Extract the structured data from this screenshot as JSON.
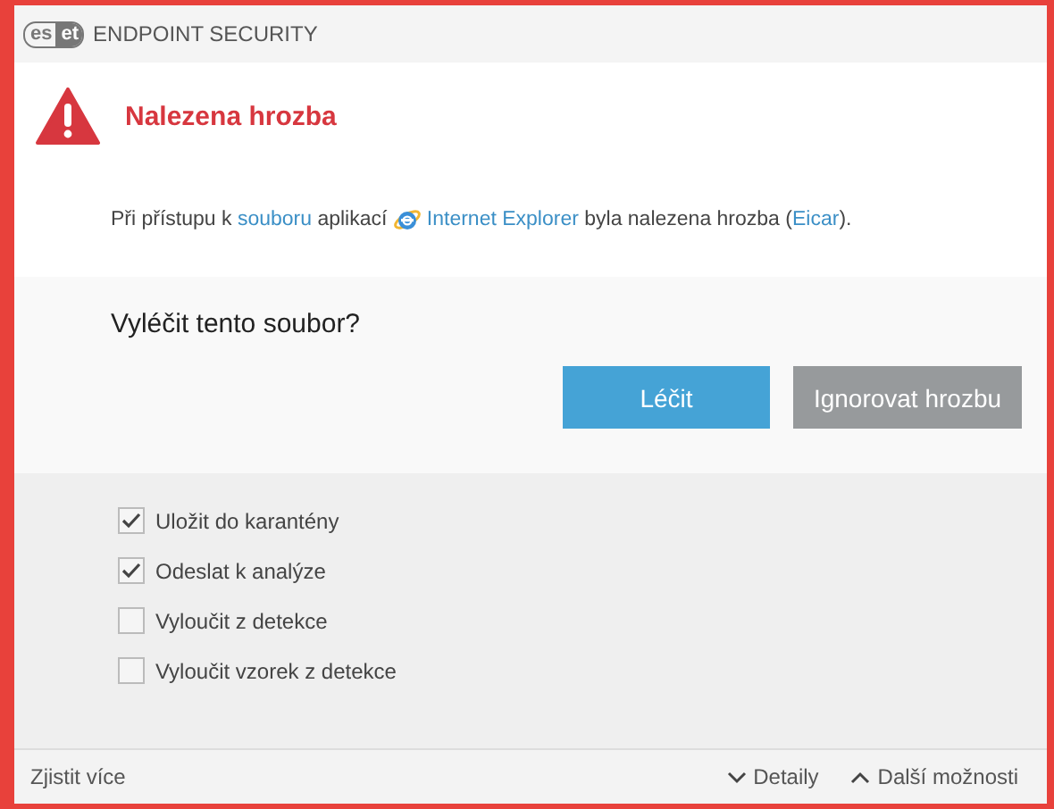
{
  "window": {
    "logo": [
      "es",
      "et"
    ],
    "title": "ENDPOINT SECURITY"
  },
  "alert": {
    "heading": "Nalezena hrozba",
    "message": [
      {
        "kind": "text",
        "text": "Při přístupu k "
      },
      {
        "kind": "link",
        "text": "souboru"
      },
      {
        "kind": "text",
        "text": " aplikací "
      },
      {
        "kind": "app",
        "text": "Internet Explorer"
      },
      {
        "kind": "text",
        "text": " byla nalezena hrozba ("
      },
      {
        "kind": "link",
        "text": "Eicar"
      },
      {
        "kind": "text",
        "text": ")."
      }
    ]
  },
  "question": "Vyléčit tento soubor?",
  "buttons": [
    {
      "label": "Léčit",
      "kind": "primary"
    },
    {
      "label": "Ignorovat hrozbu",
      "kind": "secondary"
    }
  ],
  "options": [
    {
      "label": "Uložit do karantény",
      "checked": true
    },
    {
      "label": "Odeslat k analýze",
      "checked": true
    },
    {
      "label": "Vyloučit z detekce",
      "checked": false
    },
    {
      "label": "Vyloučit vzorek z detekce",
      "checked": false
    }
  ],
  "footer": {
    "link": "Zjistit více",
    "toggles": [
      {
        "label": "Detaily",
        "expanded": false
      },
      {
        "label": "Další možnosti",
        "expanded": true
      }
    ]
  }
}
